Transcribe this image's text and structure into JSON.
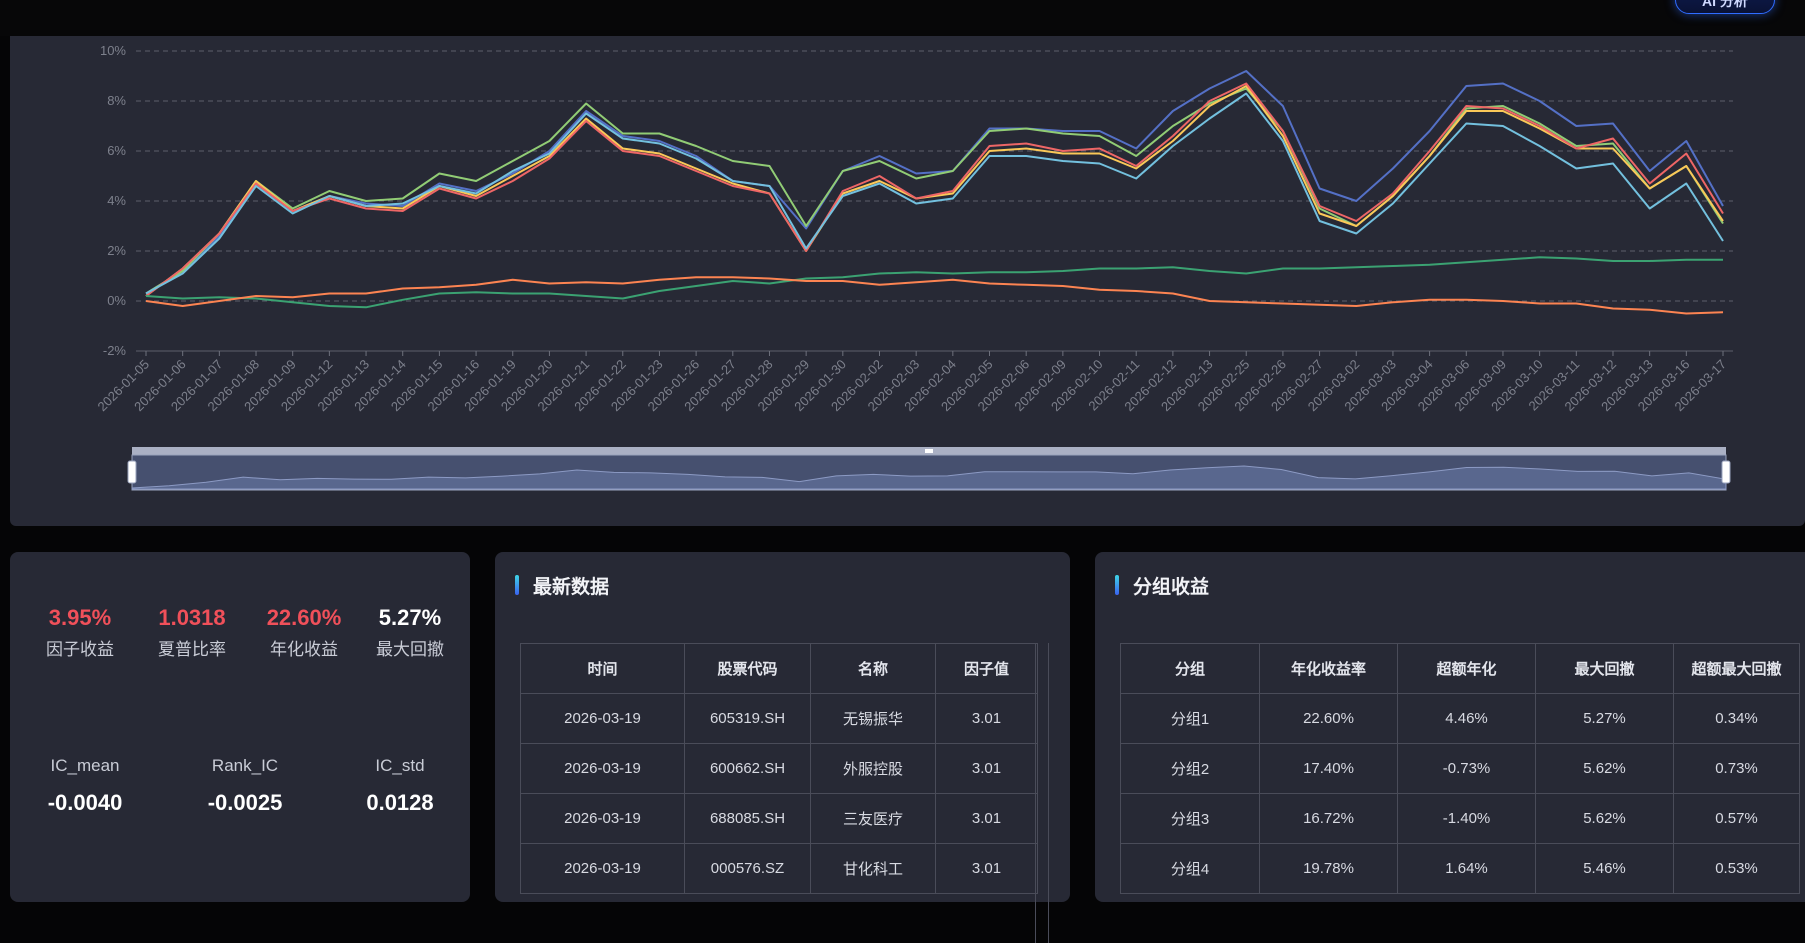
{
  "header": {
    "ai_button_label": "AI 分析"
  },
  "chart_data": {
    "type": "line",
    "x": [
      "2026-01-05",
      "2026-01-06",
      "2026-01-07",
      "2026-01-08",
      "2026-01-09",
      "2026-01-12",
      "2026-01-13",
      "2026-01-14",
      "2026-01-15",
      "2026-01-16",
      "2026-01-19",
      "2026-01-20",
      "2026-01-21",
      "2026-01-22",
      "2026-01-23",
      "2026-01-26",
      "2026-01-27",
      "2026-01-28",
      "2026-01-29",
      "2026-01-30",
      "2026-02-02",
      "2026-02-03",
      "2026-02-04",
      "2026-02-05",
      "2026-02-06",
      "2026-02-09",
      "2026-02-10",
      "2026-02-11",
      "2026-02-12",
      "2026-02-13",
      "2026-02-25",
      "2026-02-26",
      "2026-02-27",
      "2026-03-02",
      "2026-03-03",
      "2026-03-04",
      "2026-03-06",
      "2026-03-09",
      "2026-03-10",
      "2026-03-11",
      "2026-03-12",
      "2026-03-13",
      "2026-03-16",
      "2026-03-17"
    ],
    "y_ticks": [
      "10%",
      "8%",
      "6%",
      "4%",
      "2%",
      "0%",
      "-2%"
    ],
    "ylim": [
      -2,
      10
    ],
    "series": [
      {
        "color": "#5470c6",
        "values": [
          0.3,
          1.2,
          2.6,
          4.7,
          3.6,
          4.2,
          3.9,
          3.8,
          4.7,
          4.4,
          5.1,
          6.0,
          7.6,
          6.6,
          6.4,
          5.8,
          4.8,
          4.6,
          2.9,
          5.2,
          5.8,
          5.1,
          5.2,
          6.9,
          6.9,
          6.8,
          6.8,
          6.1,
          7.6,
          8.5,
          9.2,
          7.8,
          4.5,
          4.0,
          5.3,
          6.8,
          8.6,
          8.7,
          8.0,
          7.0,
          7.1,
          5.2,
          6.4,
          3.8
        ]
      },
      {
        "color": "#91cc75",
        "values": [
          0.3,
          1.2,
          2.7,
          4.8,
          3.7,
          4.4,
          4.0,
          4.1,
          5.1,
          4.8,
          5.6,
          6.4,
          7.9,
          6.7,
          6.7,
          6.2,
          5.6,
          5.4,
          3.0,
          5.2,
          5.6,
          4.9,
          5.2,
          6.8,
          6.9,
          6.7,
          6.6,
          5.8,
          7.0,
          7.9,
          8.5,
          6.8,
          3.7,
          3.0,
          4.2,
          5.8,
          7.7,
          7.8,
          7.1,
          6.2,
          6.3,
          4.5,
          5.4,
          3.1
        ]
      },
      {
        "color": "#fac858",
        "values": [
          0.2,
          1.3,
          2.7,
          4.8,
          3.6,
          4.2,
          3.8,
          3.7,
          4.6,
          4.2,
          5.0,
          5.8,
          7.3,
          6.1,
          5.9,
          5.3,
          4.7,
          4.3,
          2.0,
          4.3,
          4.8,
          4.1,
          4.3,
          6.0,
          6.1,
          5.9,
          5.9,
          5.3,
          6.4,
          7.8,
          8.6,
          6.6,
          3.5,
          3.0,
          4.2,
          5.8,
          7.6,
          7.6,
          6.9,
          6.1,
          6.1,
          4.5,
          5.4,
          3.2
        ]
      },
      {
        "color": "#ee6666",
        "values": [
          0.2,
          1.3,
          2.7,
          4.7,
          3.6,
          4.1,
          3.7,
          3.6,
          4.5,
          4.1,
          4.8,
          5.7,
          7.2,
          6.0,
          5.8,
          5.2,
          4.6,
          4.3,
          2.0,
          4.4,
          5.0,
          4.1,
          4.4,
          6.2,
          6.3,
          6.0,
          6.1,
          5.4,
          6.6,
          8.0,
          8.7,
          6.8,
          3.8,
          3.2,
          4.3,
          6.0,
          7.8,
          7.7,
          7.0,
          6.1,
          6.5,
          4.7,
          5.9,
          3.5
        ]
      },
      {
        "color": "#73c0de",
        "values": [
          0.3,
          1.1,
          2.5,
          4.6,
          3.5,
          4.2,
          3.8,
          3.9,
          4.6,
          4.3,
          5.2,
          5.9,
          7.5,
          6.5,
          6.3,
          5.7,
          4.8,
          4.6,
          2.1,
          4.2,
          4.7,
          3.9,
          4.1,
          5.8,
          5.8,
          5.6,
          5.5,
          4.9,
          6.2,
          7.3,
          8.3,
          6.4,
          3.2,
          2.7,
          3.9,
          5.5,
          7.1,
          7.0,
          6.2,
          5.3,
          5.5,
          3.7,
          4.7,
          2.4
        ]
      },
      {
        "color": "#3ba272",
        "values": [
          0.2,
          0.1,
          0.15,
          0.1,
          -0.05,
          -0.2,
          -0.25,
          0.05,
          0.3,
          0.35,
          0.3,
          0.3,
          0.2,
          0.1,
          0.4,
          0.6,
          0.8,
          0.7,
          0.9,
          0.95,
          1.1,
          1.15,
          1.1,
          1.15,
          1.15,
          1.2,
          1.3,
          1.3,
          1.35,
          1.2,
          1.1,
          1.3,
          1.3,
          1.35,
          1.4,
          1.45,
          1.55,
          1.65,
          1.75,
          1.7,
          1.6,
          1.6,
          1.65,
          1.65
        ]
      },
      {
        "color": "#fc8452",
        "values": [
          0.0,
          -0.2,
          0.0,
          0.2,
          0.15,
          0.3,
          0.3,
          0.5,
          0.55,
          0.65,
          0.85,
          0.7,
          0.75,
          0.7,
          0.85,
          0.95,
          0.95,
          0.9,
          0.8,
          0.8,
          0.65,
          0.75,
          0.85,
          0.7,
          0.65,
          0.6,
          0.45,
          0.4,
          0.3,
          0.0,
          -0.05,
          -0.1,
          -0.15,
          -0.2,
          -0.05,
          0.05,
          0.05,
          0.0,
          -0.1,
          -0.1,
          -0.3,
          -0.35,
          -0.5,
          -0.45
        ]
      }
    ],
    "legend": "none",
    "grid": "dashed-horizontal"
  },
  "metrics": [
    {
      "value": "3.95%",
      "label": "因子收益"
    },
    {
      "value": "1.0318",
      "label": "夏普比率"
    },
    {
      "value": "22.60%",
      "label": "年化收益"
    },
    {
      "value": "5.27%",
      "label": "最大回撤"
    }
  ],
  "ic_stats": [
    {
      "label": "IC_mean",
      "value": "-0.0040"
    },
    {
      "label": "Rank_IC",
      "value": "-0.0025"
    },
    {
      "label": "IC_std",
      "value": "0.0128"
    }
  ],
  "latest": {
    "title": "最新数据",
    "columns": [
      "时间",
      "股票代码",
      "名称",
      "因子值"
    ],
    "rows": [
      [
        "2026-03-19",
        "605319.SH",
        "无锡振华",
        "3.01"
      ],
      [
        "2026-03-19",
        "600662.SH",
        "外服控股",
        "3.01"
      ],
      [
        "2026-03-19",
        "688085.SH",
        "三友医疗",
        "3.01"
      ],
      [
        "2026-03-19",
        "000576.SZ",
        "甘化科工",
        "3.01"
      ]
    ]
  },
  "groups": {
    "title": "分组收益",
    "columns": [
      "分组",
      "年化收益率",
      "超额年化",
      "最大回撤",
      "超额最大回撤"
    ],
    "rows": [
      [
        "分组1",
        "22.60%",
        "4.46%",
        "5.27%",
        "0.34%"
      ],
      [
        "分组2",
        "17.40%",
        "-0.73%",
        "5.62%",
        "0.73%"
      ],
      [
        "分组3",
        "16.72%",
        "-1.40%",
        "5.62%",
        "0.57%"
      ],
      [
        "分组4",
        "19.78%",
        "1.64%",
        "5.46%",
        "0.53%"
      ]
    ]
  }
}
